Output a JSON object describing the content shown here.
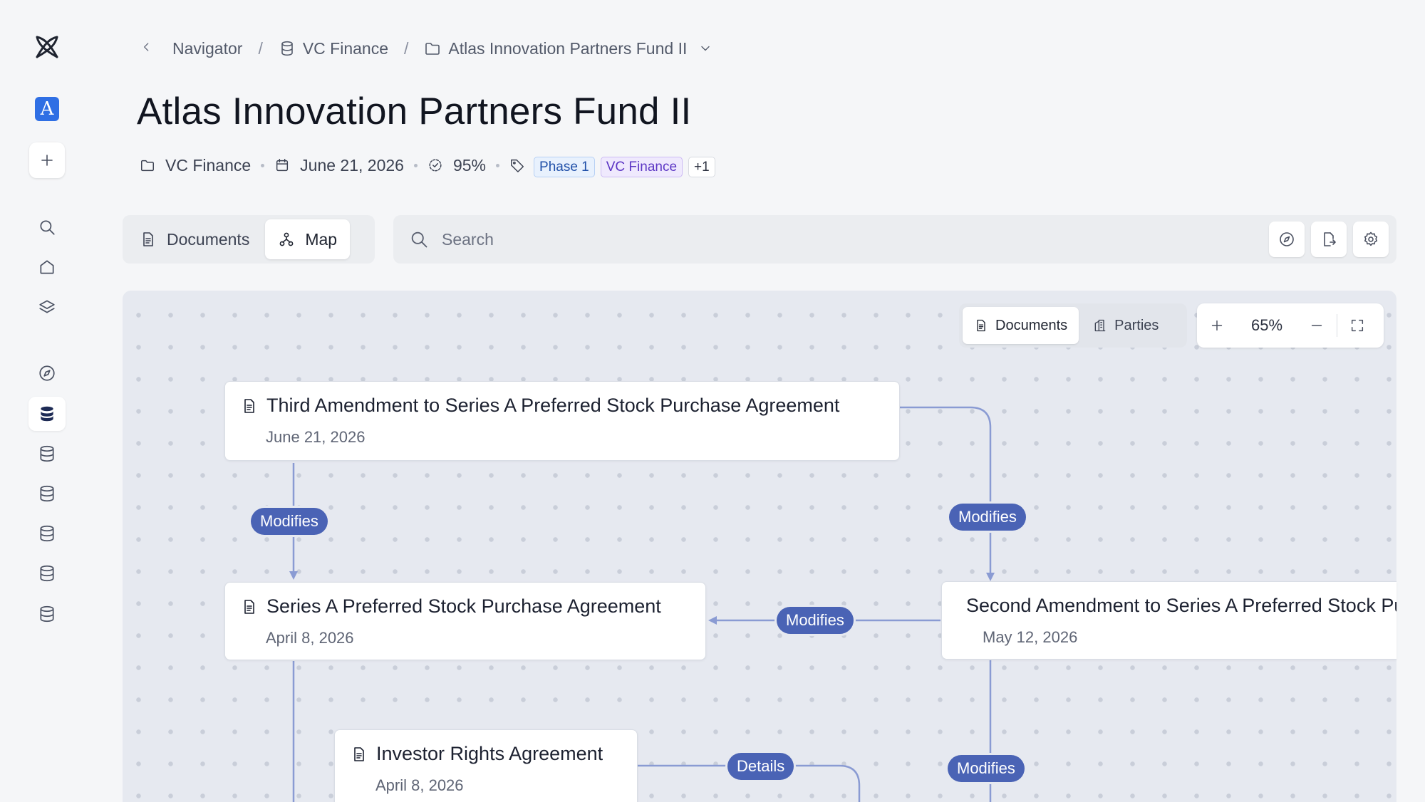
{
  "breadcrumb": {
    "items": [
      "Navigator",
      "VC Finance",
      "Atlas Innovation Partners Fund II"
    ],
    "separator": "/"
  },
  "page": {
    "title": "Atlas Innovation Partners Fund II",
    "meta": {
      "folder": "VC Finance",
      "date": "June 21, 2026",
      "progress": "95%",
      "tags": [
        "Phase 1",
        "VC Finance"
      ],
      "more_tags": "+1"
    }
  },
  "workspace": {
    "letter": "A",
    "color": "#2f6fe4"
  },
  "view_tabs": [
    {
      "label": "Documents",
      "icon": "document-icon",
      "active": false
    },
    {
      "label": "Map",
      "icon": "network-icon",
      "active": true
    }
  ],
  "search": {
    "placeholder": "Search",
    "value": ""
  },
  "canvas": {
    "tabs": [
      {
        "label": "Documents",
        "icon": "document-icon",
        "active": true
      },
      {
        "label": "Parties",
        "icon": "building-icon",
        "active": false
      }
    ],
    "zoom": "65%"
  },
  "nodes": [
    {
      "title": "Third Amendment to Series A Preferred Stock Purchase Agreement",
      "date": "June 21, 2026"
    },
    {
      "title": "Series A Preferred Stock Purchase Agreement",
      "date": "April 8, 2026"
    },
    {
      "title": "Second Amendment to Series A Preferred Stock Purchase Agreement",
      "date": "May 12, 2026"
    },
    {
      "title": "Investor Rights Agreement",
      "date": "April 8, 2026"
    }
  ],
  "edges": [
    "Modifies",
    "Modifies",
    "Modifies",
    "Details",
    "Modifies"
  ],
  "colors": {
    "edge_label_bg": "#4a63b5",
    "edge_line": "#8a9bd3",
    "canvas_bg": "#e6e9f0",
    "tag_blue": "#1f4fa8",
    "tag_purple": "#5b35c4"
  }
}
